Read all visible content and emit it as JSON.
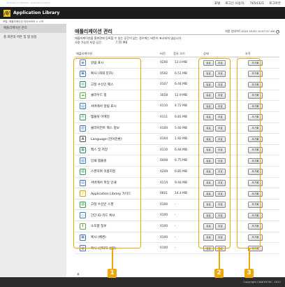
{
  "top": {
    "crumb": "Remote UI / Settings / Application Library",
    "menu": [
      "포털",
      "로그인 사용자:",
      "7654321",
      "로그아웃"
    ]
  },
  "titlebar": {
    "logo": "/I/",
    "title": "Application Library"
  },
  "subcrumb": "포털: 애플리케이션 라이브러리 > 시작",
  "sidebar": {
    "items": [
      {
        "label": "애플리케이션 관리",
        "active": true
      },
      {
        "label": "홈 화면의 버튼 및 탭 설정",
        "active": false
      }
    ]
  },
  "main": {
    "title": "애플리케이션 관리",
    "updated": "최종 업데이트:2022 02/02 10:57:57 AM",
    "description": "애플리케이션을 홈화면에 등록할 수 있는 공간이 없는 경우에는 버튼이 표시되지 않습니다.",
    "storage_label": "사용 가능한 저장 공간:",
    "storage_value": "7.55 MB",
    "headers": {
      "name": "애플리케이션",
      "version": "버전",
      "size": "점유 크기",
      "status": "상태",
      "action": "조작"
    },
    "rows": [
      {
        "name": "알림 표시",
        "version": "0200",
        "size": "13.0 MB",
        "status": "유효",
        "stop": "무효",
        "action": "초기화",
        "icon": "bell",
        "color": "#5c7fbd"
      },
      {
        "name": "복사 (최대 문자)",
        "version": "0502",
        "size": "6.51 MB",
        "status": "유효",
        "stop": "무효",
        "action": "초기화",
        "icon": "copy",
        "color": "#4c73b8"
      },
      {
        "name": "고정 수신인 팩스",
        "version": "0107",
        "size": "6.44 MB",
        "status": "유효",
        "stop": "무효",
        "action": "초기화",
        "icon": "fax",
        "color": "#2f8a59"
      },
      {
        "name": "클라우드 접",
        "version": "3058",
        "size": "12.9 MB",
        "status": "유효",
        "stop": "무효",
        "action": "초기화",
        "icon": "cloud",
        "color": "#6aa84f"
      },
      {
        "name": "서버에서 알림 표시",
        "version": "0110",
        "size": "4.72 MB",
        "status": "유효",
        "stop": "무효",
        "action": "초기화",
        "icon": "server",
        "color": "#3d7ac8"
      },
      {
        "name": "템플릿 이메일",
        "version": "0111",
        "size": "6.81 MB",
        "status": "유효",
        "stop": "무효",
        "action": "초기화",
        "icon": "mail",
        "color": "#3b9a5a"
      },
      {
        "name": "클라이언트 팩스 정보",
        "version": "0100",
        "size": "5.92 MB",
        "status": "유효",
        "stop": "무효",
        "action": "초기화",
        "icon": "fax-client",
        "color": "#4c73b8"
      },
      {
        "name": "Language (언어전환)",
        "version": "0104",
        "size": "1.92 MB",
        "status": "유효",
        "stop": "무효",
        "action": "초기화",
        "icon": "language",
        "color": "#555555"
      },
      {
        "name": "팩스 및 저장",
        "version": "0110",
        "size": "6.44 MB",
        "status": "유효",
        "stop": "무효",
        "action": "초기화",
        "icon": "fax-store",
        "color": "#2f8a59"
      },
      {
        "name": "인쇄 템플릿",
        "version": "0408",
        "size": "6.75 MB",
        "status": "유효",
        "stop": "무효",
        "action": "초기화",
        "icon": "print",
        "color": "#3d7ac8"
      },
      {
        "name": "스캔하여 이름지정",
        "version": "0209",
        "size": "6.85 MB",
        "status": "유효",
        "stop": "무효",
        "action": "초기화",
        "icon": "scan",
        "color": "#3b9a5a"
      },
      {
        "name": "서버에서 파일 인쇄",
        "version": "0114",
        "size": "9.44 MB",
        "status": "유효",
        "stop": "무효",
        "action": "초기화",
        "icon": "server-print",
        "color": "#4c73b8"
      },
      {
        "name": "Application Library 가이드",
        "version": "0601",
        "size": "14.4 MB",
        "status": "유효",
        "stop": "무효",
        "action": "초기화",
        "icon": "guide",
        "color": "#d9a400"
      },
      {
        "name": "고정 수신인 스캔",
        "version": "0100",
        "size": "-",
        "status": "유효",
        "stop": "무효",
        "action": "초기화",
        "icon": "scan-fixed",
        "color": "#3b9a5a"
      },
      {
        "name": "간단 ID 카드 복사",
        "version": "0100",
        "size": "-",
        "status": "유효",
        "stop": "무효",
        "action": "초기화",
        "icon": "id-card",
        "color": "#3d7ac8"
      },
      {
        "name": "소모품 정보",
        "version": "0100",
        "size": "-",
        "status": "유효",
        "stop": "무효",
        "action": "초기화",
        "icon": "info",
        "color": "#6aa84f"
      },
      {
        "name": "복사 (배경)",
        "version": "0100",
        "size": "-",
        "status": "유효",
        "stop": "무효",
        "action": "초기화",
        "icon": "copy-bg",
        "color": "#4c73b8"
      },
      {
        "name": "복사 (원터치 설정)",
        "version": "0100",
        "size": "-",
        "status": "유효",
        "stop": "무효",
        "action": "초기화",
        "icon": "copy-touch",
        "color": "#4c73b8"
      }
    ],
    "footer_note": "표"
  },
  "footer": {
    "copyright": "Copyright CANON INC. 2022"
  },
  "callouts": [
    "1",
    "2",
    "3"
  ],
  "accent_color": "#f0a800"
}
